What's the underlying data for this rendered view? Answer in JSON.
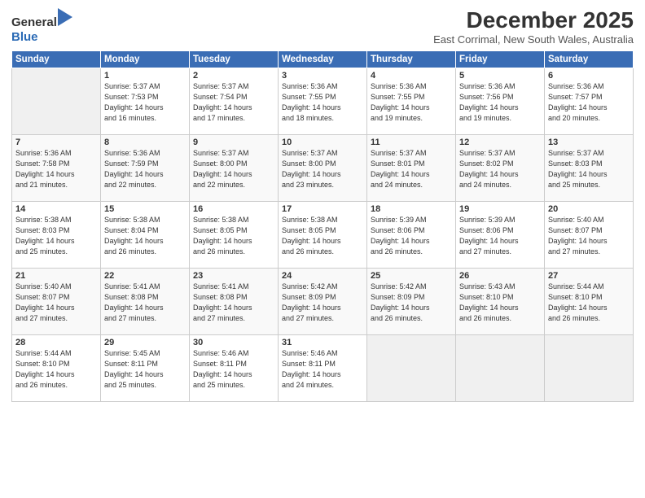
{
  "header": {
    "logo_line1": "General",
    "logo_line2": "Blue",
    "month": "December 2025",
    "location": "East Corrimal, New South Wales, Australia"
  },
  "days_of_week": [
    "Sunday",
    "Monday",
    "Tuesday",
    "Wednesday",
    "Thursday",
    "Friday",
    "Saturday"
  ],
  "weeks": [
    [
      {
        "day": "",
        "info": ""
      },
      {
        "day": "1",
        "info": "Sunrise: 5:37 AM\nSunset: 7:53 PM\nDaylight: 14 hours\nand 16 minutes."
      },
      {
        "day": "2",
        "info": "Sunrise: 5:37 AM\nSunset: 7:54 PM\nDaylight: 14 hours\nand 17 minutes."
      },
      {
        "day": "3",
        "info": "Sunrise: 5:36 AM\nSunset: 7:55 PM\nDaylight: 14 hours\nand 18 minutes."
      },
      {
        "day": "4",
        "info": "Sunrise: 5:36 AM\nSunset: 7:55 PM\nDaylight: 14 hours\nand 19 minutes."
      },
      {
        "day": "5",
        "info": "Sunrise: 5:36 AM\nSunset: 7:56 PM\nDaylight: 14 hours\nand 19 minutes."
      },
      {
        "day": "6",
        "info": "Sunrise: 5:36 AM\nSunset: 7:57 PM\nDaylight: 14 hours\nand 20 minutes."
      }
    ],
    [
      {
        "day": "7",
        "info": "Sunrise: 5:36 AM\nSunset: 7:58 PM\nDaylight: 14 hours\nand 21 minutes."
      },
      {
        "day": "8",
        "info": "Sunrise: 5:36 AM\nSunset: 7:59 PM\nDaylight: 14 hours\nand 22 minutes."
      },
      {
        "day": "9",
        "info": "Sunrise: 5:37 AM\nSunset: 8:00 PM\nDaylight: 14 hours\nand 22 minutes."
      },
      {
        "day": "10",
        "info": "Sunrise: 5:37 AM\nSunset: 8:00 PM\nDaylight: 14 hours\nand 23 minutes."
      },
      {
        "day": "11",
        "info": "Sunrise: 5:37 AM\nSunset: 8:01 PM\nDaylight: 14 hours\nand 24 minutes."
      },
      {
        "day": "12",
        "info": "Sunrise: 5:37 AM\nSunset: 8:02 PM\nDaylight: 14 hours\nand 24 minutes."
      },
      {
        "day": "13",
        "info": "Sunrise: 5:37 AM\nSunset: 8:03 PM\nDaylight: 14 hours\nand 25 minutes."
      }
    ],
    [
      {
        "day": "14",
        "info": "Sunrise: 5:38 AM\nSunset: 8:03 PM\nDaylight: 14 hours\nand 25 minutes."
      },
      {
        "day": "15",
        "info": "Sunrise: 5:38 AM\nSunset: 8:04 PM\nDaylight: 14 hours\nand 26 minutes."
      },
      {
        "day": "16",
        "info": "Sunrise: 5:38 AM\nSunset: 8:05 PM\nDaylight: 14 hours\nand 26 minutes."
      },
      {
        "day": "17",
        "info": "Sunrise: 5:38 AM\nSunset: 8:05 PM\nDaylight: 14 hours\nand 26 minutes."
      },
      {
        "day": "18",
        "info": "Sunrise: 5:39 AM\nSunset: 8:06 PM\nDaylight: 14 hours\nand 26 minutes."
      },
      {
        "day": "19",
        "info": "Sunrise: 5:39 AM\nSunset: 8:06 PM\nDaylight: 14 hours\nand 27 minutes."
      },
      {
        "day": "20",
        "info": "Sunrise: 5:40 AM\nSunset: 8:07 PM\nDaylight: 14 hours\nand 27 minutes."
      }
    ],
    [
      {
        "day": "21",
        "info": "Sunrise: 5:40 AM\nSunset: 8:07 PM\nDaylight: 14 hours\nand 27 minutes."
      },
      {
        "day": "22",
        "info": "Sunrise: 5:41 AM\nSunset: 8:08 PM\nDaylight: 14 hours\nand 27 minutes."
      },
      {
        "day": "23",
        "info": "Sunrise: 5:41 AM\nSunset: 8:08 PM\nDaylight: 14 hours\nand 27 minutes."
      },
      {
        "day": "24",
        "info": "Sunrise: 5:42 AM\nSunset: 8:09 PM\nDaylight: 14 hours\nand 27 minutes."
      },
      {
        "day": "25",
        "info": "Sunrise: 5:42 AM\nSunset: 8:09 PM\nDaylight: 14 hours\nand 26 minutes."
      },
      {
        "day": "26",
        "info": "Sunrise: 5:43 AM\nSunset: 8:10 PM\nDaylight: 14 hours\nand 26 minutes."
      },
      {
        "day": "27",
        "info": "Sunrise: 5:44 AM\nSunset: 8:10 PM\nDaylight: 14 hours\nand 26 minutes."
      }
    ],
    [
      {
        "day": "28",
        "info": "Sunrise: 5:44 AM\nSunset: 8:10 PM\nDaylight: 14 hours\nand 26 minutes."
      },
      {
        "day": "29",
        "info": "Sunrise: 5:45 AM\nSunset: 8:11 PM\nDaylight: 14 hours\nand 25 minutes."
      },
      {
        "day": "30",
        "info": "Sunrise: 5:46 AM\nSunset: 8:11 PM\nDaylight: 14 hours\nand 25 minutes."
      },
      {
        "day": "31",
        "info": "Sunrise: 5:46 AM\nSunset: 8:11 PM\nDaylight: 14 hours\nand 24 minutes."
      },
      {
        "day": "",
        "info": ""
      },
      {
        "day": "",
        "info": ""
      },
      {
        "day": "",
        "info": ""
      }
    ]
  ]
}
